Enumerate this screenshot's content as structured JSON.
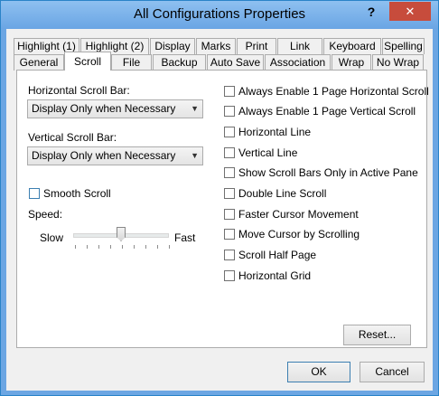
{
  "window": {
    "title": "All Configurations Properties",
    "help_label": "?",
    "close_label": "✕"
  },
  "tabs": {
    "row_back": [
      "Highlight (1)",
      "Highlight (2)",
      "Display",
      "Marks",
      "Print",
      "Link",
      "Keyboard",
      "Spelling"
    ],
    "row_front": [
      "General",
      "Scroll",
      "File",
      "Backup",
      "Auto Save",
      "Association",
      "Wrap",
      "No Wrap"
    ],
    "active": "Scroll"
  },
  "scroll": {
    "horizontal_label": "Horizontal Scroll Bar:",
    "horizontal_value": "Display Only when Necessary",
    "vertical_label": "Vertical Scroll Bar:",
    "vertical_value": "Display Only when Necessary",
    "smooth_scroll": "Smooth Scroll",
    "speed_label": "Speed:",
    "slow_label": "Slow",
    "fast_label": "Fast",
    "speed_level": 0.5
  },
  "options": [
    "Always Enable 1 Page Horizontal Scroll",
    "Always Enable 1 Page Vertical Scroll",
    "Horizontal Line",
    "Vertical Line",
    "Show Scroll Bars Only in Active Pane",
    "Double Line Scroll",
    "Faster Cursor Movement",
    "Move Cursor by Scrolling",
    "Scroll Half Page",
    "Horizontal Grid"
  ],
  "buttons": {
    "reset": "Reset...",
    "ok": "OK",
    "cancel": "Cancel"
  }
}
